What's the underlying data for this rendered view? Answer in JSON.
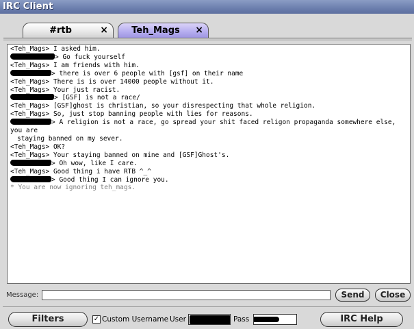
{
  "window": {
    "title": "IRC Client"
  },
  "tabs": [
    {
      "label": "#rtb",
      "close": "×"
    },
    {
      "label": "Teh_Mags",
      "close": "×"
    }
  ],
  "chat": {
    "lines": [
      {
        "nick": "<Teh_Mags>",
        "text": "I asked him.",
        "redacted": false
      },
      {
        "nick": "",
        "text": "Go fuck yourself",
        "redacted": true,
        "redact_width": 65
      },
      {
        "nick": "<Teh_Mags>",
        "text": "I am friends with him.",
        "redacted": false
      },
      {
        "nick": "",
        "text": "there is over 6 people with [gsf] on their name",
        "redacted": true,
        "redact_width": 60
      },
      {
        "nick": "<Teh_Mags>",
        "text": "There is is over 14000 people without it.",
        "redacted": false
      },
      {
        "nick": "<Teh_Mags>",
        "text": "Your just racist.",
        "redacted": false
      },
      {
        "nick": "",
        "text": "[GSF] is not a race/",
        "redacted": true,
        "redact_width": 64
      },
      {
        "nick": "<Teh_Mags>",
        "text": "[GSF]ghost is christian, so your disrespecting that whole religion.",
        "redacted": false
      },
      {
        "nick": "<Teh_Mags>",
        "text": "So, just stop banning people with lies for reasons.",
        "redacted": false
      },
      {
        "nick": "",
        "text": "A religion is not a race, go spread your shit faced religon propaganda somewhere else, you are",
        "redacted": true,
        "redact_width": 60
      },
      {
        "nick": "",
        "text": "staying banned on my sever.",
        "redacted": false,
        "continuation": true
      },
      {
        "nick": "<Teh_Mags>",
        "text": "OK?",
        "redacted": false
      },
      {
        "nick": "<Teh_Mags>",
        "text": "Your staying banned on mine and [GSF]Ghost's.",
        "redacted": false
      },
      {
        "nick": "",
        "text": "Oh wow, like I care.",
        "redacted": true,
        "redact_width": 60
      },
      {
        "nick": "<Teh_Mags>",
        "text": "Good thing i have RTB ^_^",
        "redacted": false
      },
      {
        "nick": "",
        "text": "Good thing I can ignore you.",
        "redacted": true,
        "redact_width": 60
      },
      {
        "nick": "",
        "text": "* You are now ignoring teh_mags.",
        "redacted": false,
        "system": true
      }
    ]
  },
  "message": {
    "label": "Message:",
    "value": ""
  },
  "buttons": {
    "send": "Send",
    "close": "Close",
    "filters": "Filters",
    "irc_help": "IRC Help"
  },
  "options": {
    "custom_username_checked": true,
    "custom_username_label": "Custom Username",
    "user_label": "User",
    "pass_label": "Pass"
  },
  "colors": {
    "titlebar": "#6c7fae",
    "active_tab": "#b6aef0",
    "system_text": "#808080"
  }
}
